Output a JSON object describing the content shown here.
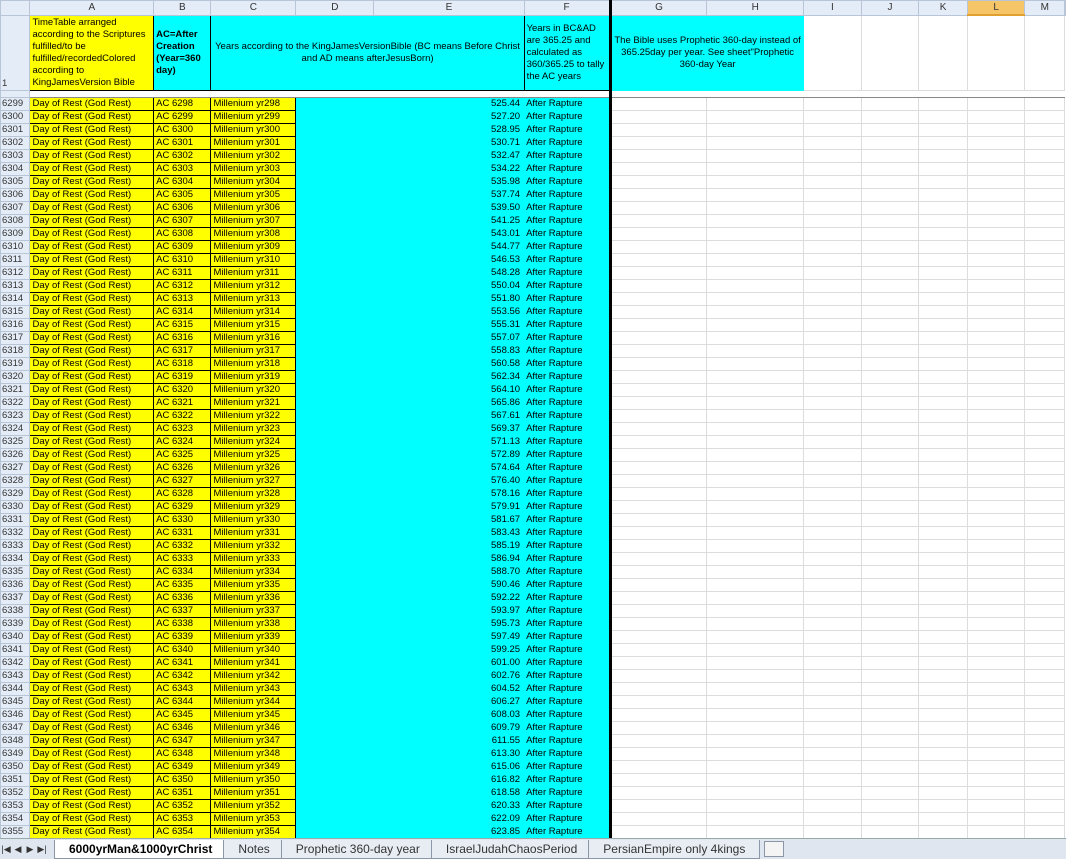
{
  "columns": [
    "A",
    "B",
    "C",
    "D",
    "E",
    "F",
    "G",
    "H",
    "I",
    "J",
    "K",
    "L",
    "M"
  ],
  "header_row": {
    "row_number": "1",
    "a": "TimeTable arranged according to the Scriptures fulfilled/to be fulfilled/recordedColored according to KingJamesVersion Bible",
    "b": "AC=After Creation (Year=360 day)",
    "cde": "Years according to the KingJamesVersionBible (BC means Before Christ and AD means afterJesusBorn)",
    "f": "Years in BC&AD are 365.25 and calculated as 360/365.25 to tally the AC years",
    "gh": "The Bible uses Prophetic 360-day instead of 365.25day per year. See sheet\"Prophetic 360-day Year"
  },
  "rows": [
    {
      "r": "6299",
      "a": "Day of Rest (God Rest)",
      "b": "AC 6298",
      "c": "Millenium yr298",
      "e": "525.44",
      "f": "After Rapture"
    },
    {
      "r": "6300",
      "a": "Day of Rest (God Rest)",
      "b": "AC 6299",
      "c": "Millenium yr299",
      "e": "527.20",
      "f": "After Rapture"
    },
    {
      "r": "6301",
      "a": "Day of Rest (God Rest)",
      "b": "AC 6300",
      "c": "Millenium yr300",
      "e": "528.95",
      "f": "After Rapture"
    },
    {
      "r": "6302",
      "a": "Day of Rest (God Rest)",
      "b": "AC 6301",
      "c": "Millenium yr301",
      "e": "530.71",
      "f": "After Rapture"
    },
    {
      "r": "6303",
      "a": "Day of Rest (God Rest)",
      "b": "AC 6302",
      "c": "Millenium yr302",
      "e": "532.47",
      "f": "After Rapture"
    },
    {
      "r": "6304",
      "a": "Day of Rest (God Rest)",
      "b": "AC 6303",
      "c": "Millenium yr303",
      "e": "534.22",
      "f": "After Rapture"
    },
    {
      "r": "6305",
      "a": "Day of Rest (God Rest)",
      "b": "AC 6304",
      "c": "Millenium yr304",
      "e": "535.98",
      "f": "After Rapture"
    },
    {
      "r": "6306",
      "a": "Day of Rest (God Rest)",
      "b": "AC 6305",
      "c": "Millenium yr305",
      "e": "537.74",
      "f": "After Rapture"
    },
    {
      "r": "6307",
      "a": "Day of Rest (God Rest)",
      "b": "AC 6306",
      "c": "Millenium yr306",
      "e": "539.50",
      "f": "After Rapture"
    },
    {
      "r": "6308",
      "a": "Day of Rest (God Rest)",
      "b": "AC 6307",
      "c": "Millenium yr307",
      "e": "541.25",
      "f": "After Rapture"
    },
    {
      "r": "6309",
      "a": "Day of Rest (God Rest)",
      "b": "AC 6308",
      "c": "Millenium yr308",
      "e": "543.01",
      "f": "After Rapture"
    },
    {
      "r": "6310",
      "a": "Day of Rest (God Rest)",
      "b": "AC 6309",
      "c": "Millenium yr309",
      "e": "544.77",
      "f": "After Rapture"
    },
    {
      "r": "6311",
      "a": "Day of Rest (God Rest)",
      "b": "AC 6310",
      "c": "Millenium yr310",
      "e": "546.53",
      "f": "After Rapture"
    },
    {
      "r": "6312",
      "a": "Day of Rest (God Rest)",
      "b": "AC 6311",
      "c": "Millenium yr311",
      "e": "548.28",
      "f": "After Rapture"
    },
    {
      "r": "6313",
      "a": "Day of Rest (God Rest)",
      "b": "AC 6312",
      "c": "Millenium yr312",
      "e": "550.04",
      "f": "After Rapture"
    },
    {
      "r": "6314",
      "a": "Day of Rest (God Rest)",
      "b": "AC 6313",
      "c": "Millenium yr313",
      "e": "551.80",
      "f": "After Rapture"
    },
    {
      "r": "6315",
      "a": "Day of Rest (God Rest)",
      "b": "AC 6314",
      "c": "Millenium yr314",
      "e": "553.56",
      "f": "After Rapture"
    },
    {
      "r": "6316",
      "a": "Day of Rest (God Rest)",
      "b": "AC 6315",
      "c": "Millenium yr315",
      "e": "555.31",
      "f": "After Rapture"
    },
    {
      "r": "6317",
      "a": "Day of Rest (God Rest)",
      "b": "AC 6316",
      "c": "Millenium yr316",
      "e": "557.07",
      "f": "After Rapture"
    },
    {
      "r": "6318",
      "a": "Day of Rest (God Rest)",
      "b": "AC 6317",
      "c": "Millenium yr317",
      "e": "558.83",
      "f": "After Rapture"
    },
    {
      "r": "6319",
      "a": "Day of Rest (God Rest)",
      "b": "AC 6318",
      "c": "Millenium yr318",
      "e": "560.58",
      "f": "After Rapture"
    },
    {
      "r": "6320",
      "a": "Day of Rest (God Rest)",
      "b": "AC 6319",
      "c": "Millenium yr319",
      "e": "562.34",
      "f": "After Rapture"
    },
    {
      "r": "6321",
      "a": "Day of Rest (God Rest)",
      "b": "AC 6320",
      "c": "Millenium yr320",
      "e": "564.10",
      "f": "After Rapture"
    },
    {
      "r": "6322",
      "a": "Day of Rest (God Rest)",
      "b": "AC 6321",
      "c": "Millenium yr321",
      "e": "565.86",
      "f": "After Rapture"
    },
    {
      "r": "6323",
      "a": "Day of Rest (God Rest)",
      "b": "AC 6322",
      "c": "Millenium yr322",
      "e": "567.61",
      "f": "After Rapture"
    },
    {
      "r": "6324",
      "a": "Day of Rest (God Rest)",
      "b": "AC 6323",
      "c": "Millenium yr323",
      "e": "569.37",
      "f": "After Rapture"
    },
    {
      "r": "6325",
      "a": "Day of Rest (God Rest)",
      "b": "AC 6324",
      "c": "Millenium yr324",
      "e": "571.13",
      "f": "After Rapture"
    },
    {
      "r": "6326",
      "a": "Day of Rest (God Rest)",
      "b": "AC 6325",
      "c": "Millenium yr325",
      "e": "572.89",
      "f": "After Rapture"
    },
    {
      "r": "6327",
      "a": "Day of Rest (God Rest)",
      "b": "AC 6326",
      "c": "Millenium yr326",
      "e": "574.64",
      "f": "After Rapture"
    },
    {
      "r": "6328",
      "a": "Day of Rest (God Rest)",
      "b": "AC 6327",
      "c": "Millenium yr327",
      "e": "576.40",
      "f": "After Rapture"
    },
    {
      "r": "6329",
      "a": "Day of Rest (God Rest)",
      "b": "AC 6328",
      "c": "Millenium yr328",
      "e": "578.16",
      "f": "After Rapture"
    },
    {
      "r": "6330",
      "a": "Day of Rest (God Rest)",
      "b": "AC 6329",
      "c": "Millenium yr329",
      "e": "579.91",
      "f": "After Rapture"
    },
    {
      "r": "6331",
      "a": "Day of Rest (God Rest)",
      "b": "AC 6330",
      "c": "Millenium yr330",
      "e": "581.67",
      "f": "After Rapture"
    },
    {
      "r": "6332",
      "a": "Day of Rest (God Rest)",
      "b": "AC 6331",
      "c": "Millenium yr331",
      "e": "583.43",
      "f": "After Rapture"
    },
    {
      "r": "6333",
      "a": "Day of Rest (God Rest)",
      "b": "AC 6332",
      "c": "Millenium yr332",
      "e": "585.19",
      "f": "After Rapture"
    },
    {
      "r": "6334",
      "a": "Day of Rest (God Rest)",
      "b": "AC 6333",
      "c": "Millenium yr333",
      "e": "586.94",
      "f": "After Rapture"
    },
    {
      "r": "6335",
      "a": "Day of Rest (God Rest)",
      "b": "AC 6334",
      "c": "Millenium yr334",
      "e": "588.70",
      "f": "After Rapture"
    },
    {
      "r": "6336",
      "a": "Day of Rest (God Rest)",
      "b": "AC 6335",
      "c": "Millenium yr335",
      "e": "590.46",
      "f": "After Rapture"
    },
    {
      "r": "6337",
      "a": "Day of Rest (God Rest)",
      "b": "AC 6336",
      "c": "Millenium yr336",
      "e": "592.22",
      "f": "After Rapture"
    },
    {
      "r": "6338",
      "a": "Day of Rest (God Rest)",
      "b": "AC 6337",
      "c": "Millenium yr337",
      "e": "593.97",
      "f": "After Rapture"
    },
    {
      "r": "6339",
      "a": "Day of Rest (God Rest)",
      "b": "AC 6338",
      "c": "Millenium yr338",
      "e": "595.73",
      "f": "After Rapture"
    },
    {
      "r": "6340",
      "a": "Day of Rest (God Rest)",
      "b": "AC 6339",
      "c": "Millenium yr339",
      "e": "597.49",
      "f": "After Rapture"
    },
    {
      "r": "6341",
      "a": "Day of Rest (God Rest)",
      "b": "AC 6340",
      "c": "Millenium yr340",
      "e": "599.25",
      "f": "After Rapture"
    },
    {
      "r": "6342",
      "a": "Day of Rest (God Rest)",
      "b": "AC 6341",
      "c": "Millenium yr341",
      "e": "601.00",
      "f": "After Rapture"
    },
    {
      "r": "6343",
      "a": "Day of Rest (God Rest)",
      "b": "AC 6342",
      "c": "Millenium yr342",
      "e": "602.76",
      "f": "After Rapture"
    },
    {
      "r": "6344",
      "a": "Day of Rest (God Rest)",
      "b": "AC 6343",
      "c": "Millenium yr343",
      "e": "604.52",
      "f": "After Rapture"
    },
    {
      "r": "6345",
      "a": "Day of Rest (God Rest)",
      "b": "AC 6344",
      "c": "Millenium yr344",
      "e": "606.27",
      "f": "After Rapture"
    },
    {
      "r": "6346",
      "a": "Day of Rest (God Rest)",
      "b": "AC 6345",
      "c": "Millenium yr345",
      "e": "608.03",
      "f": "After Rapture"
    },
    {
      "r": "6347",
      "a": "Day of Rest (God Rest)",
      "b": "AC 6346",
      "c": "Millenium yr346",
      "e": "609.79",
      "f": "After Rapture"
    },
    {
      "r": "6348",
      "a": "Day of Rest (God Rest)",
      "b": "AC 6347",
      "c": "Millenium yr347",
      "e": "611.55",
      "f": "After Rapture"
    },
    {
      "r": "6349",
      "a": "Day of Rest (God Rest)",
      "b": "AC 6348",
      "c": "Millenium yr348",
      "e": "613.30",
      "f": "After Rapture"
    },
    {
      "r": "6350",
      "a": "Day of Rest (God Rest)",
      "b": "AC 6349",
      "c": "Millenium yr349",
      "e": "615.06",
      "f": "After Rapture"
    },
    {
      "r": "6351",
      "a": "Day of Rest (God Rest)",
      "b": "AC 6350",
      "c": "Millenium yr350",
      "e": "616.82",
      "f": "After Rapture"
    },
    {
      "r": "6352",
      "a": "Day of Rest (God Rest)",
      "b": "AC 6351",
      "c": "Millenium yr351",
      "e": "618.58",
      "f": "After Rapture"
    },
    {
      "r": "6353",
      "a": "Day of Rest (God Rest)",
      "b": "AC 6352",
      "c": "Millenium yr352",
      "e": "620.33",
      "f": "After Rapture"
    },
    {
      "r": "6354",
      "a": "Day of Rest (God Rest)",
      "b": "AC 6353",
      "c": "Millenium yr353",
      "e": "622.09",
      "f": "After Rapture"
    },
    {
      "r": "6355",
      "a": "Day of Rest (God Rest)",
      "b": "AC 6354",
      "c": "Millenium yr354",
      "e": "623.85",
      "f": "After Rapture"
    }
  ],
  "tabs": [
    {
      "label": "6000yrMan&1000yrChrist",
      "active": true
    },
    {
      "label": "Notes",
      "active": false
    },
    {
      "label": "Prophetic 360-day year",
      "active": false
    },
    {
      "label": "IsraelJudahChaosPeriod",
      "active": false
    },
    {
      "label": "PersianEmpire only 4kings",
      "active": false
    }
  ],
  "nav_icons": [
    "first-sheet-icon",
    "prev-sheet-icon",
    "next-sheet-icon",
    "last-sheet-icon"
  ],
  "colors": {
    "yellow": "#ffff00",
    "cyan": "#00ffff",
    "selected_header": "#f6c567"
  }
}
